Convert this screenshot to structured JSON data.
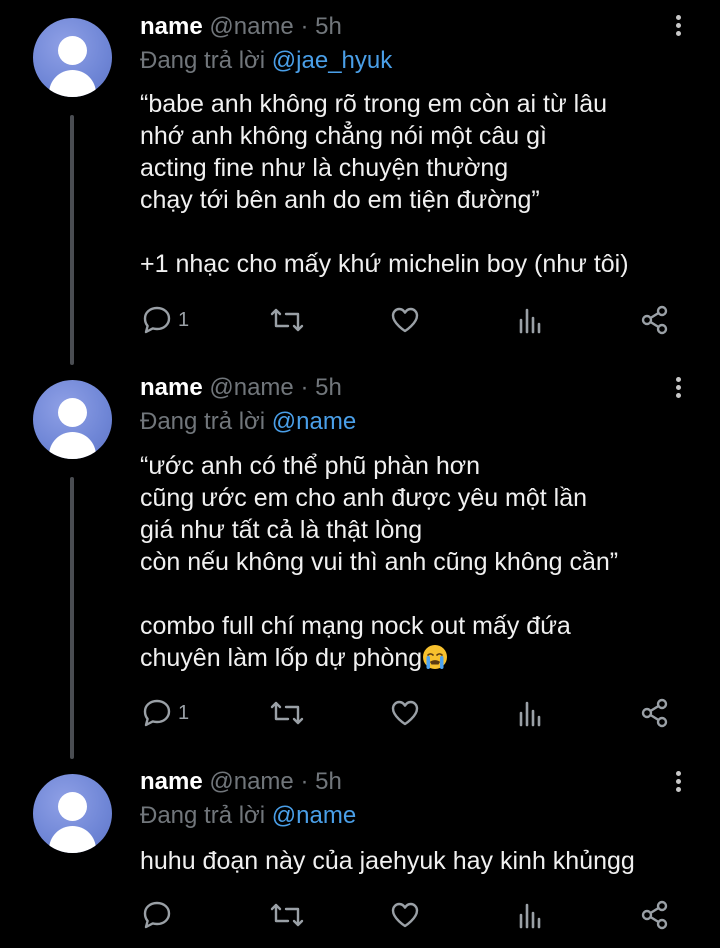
{
  "tweets": [
    {
      "name": "name",
      "handle": "@name",
      "time_meta": " · 5h",
      "reply_prefix": "Đang trả lời ",
      "reply_to": "@jae_hyuk",
      "text": "“babe anh không rõ trong em còn ai từ lâu\nnhớ anh không chẳng nói một câu gì\nacting fine như là chuyện thường\nchạy tới bên anh do em tiện đường”\n\n+1 nhạc cho mấy khứ michelin boy (như tôi)",
      "reply_count": "1"
    },
    {
      "name": "name",
      "handle": "@name",
      "time_meta": " · 5h",
      "reply_prefix": "Đang trả lời ",
      "reply_to": "@name",
      "text": "“ước anh có thể phũ phàn hơn\ncũng ước em cho anh được yêu một lần\ngiá như tất cả là thật lòng\ncòn nếu không vui thì anh cũng không cần”\n\ncombo full chí mạng nock out mấy đứa\nchuyên làm lốp dự phòng",
      "emoji": "loudly-crying-face",
      "reply_count": "1"
    },
    {
      "name": "name",
      "handle": "@name",
      "time_meta": " · 5h",
      "reply_prefix": "Đang trả lời ",
      "reply_to": "@name",
      "text": "huhu đoạn này của jaehyuk hay kinh khủngg",
      "reply_count": ""
    }
  ],
  "colors": {
    "background": "#000000",
    "primary_text": "#e7e9ea",
    "secondary_text": "#71767b",
    "link": "#4a9fe8",
    "thread_line": "#4a4d52",
    "avatar": "#6f86d6"
  },
  "icons": [
    "reply-icon",
    "retweet-icon",
    "like-icon",
    "stats-icon",
    "share-icon",
    "more-icon",
    "default-avatar-icon"
  ]
}
